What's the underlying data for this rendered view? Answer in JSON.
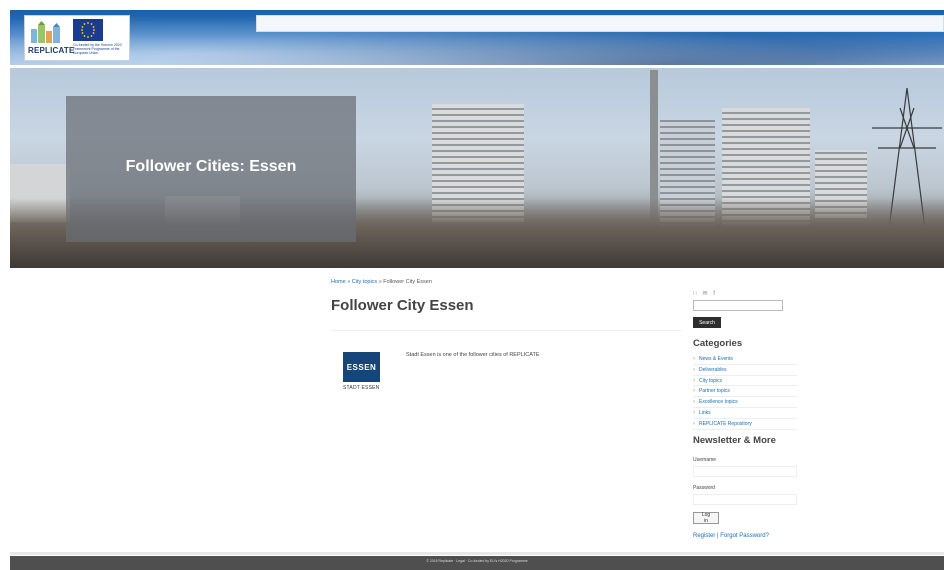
{
  "header": {
    "logo_text": "REPLICATE",
    "eu_caption": "Co-funded by the Horizon 2020 Framework Programme of the European Union"
  },
  "banner": {
    "title": "Follower Cities: Essen"
  },
  "breadcrumb": {
    "home": "Home",
    "sep1": " » ",
    "city_topics": "City topics",
    "sep2": " » ",
    "current": "Follower City Essen"
  },
  "main": {
    "title": "Follower City Essen",
    "logo_text": "ESSEN",
    "logo_sub": "STADT ESSEN",
    "intro": "Stadt Essen is one of the follower cities of REPLICATE"
  },
  "sidebar": {
    "feed_icons": [
      "rss-icon",
      "email-icon",
      "facebook-icon"
    ],
    "search_button": "Search",
    "categories_heading": "Categories",
    "categories": [
      "News & Events",
      "Deliverables",
      "City topics",
      "Partner topics",
      "Excellence topics",
      "Links",
      "REPLICATE Repository"
    ],
    "newsletter_heading": "Newsletter & More",
    "username_label": "Username",
    "password_label": "Password",
    "login_button": "Log in",
    "register_text": "Register | Forgot Password?"
  },
  "footer": {
    "text": "© 2016 Replicate · Legal · Co-funded by EU's H2020 Programme"
  },
  "colors": {
    "link": "#1a6fb5",
    "header_blue": "#2f76bf",
    "footer": "#4f4f4f",
    "essen_blue": "#16457a"
  }
}
